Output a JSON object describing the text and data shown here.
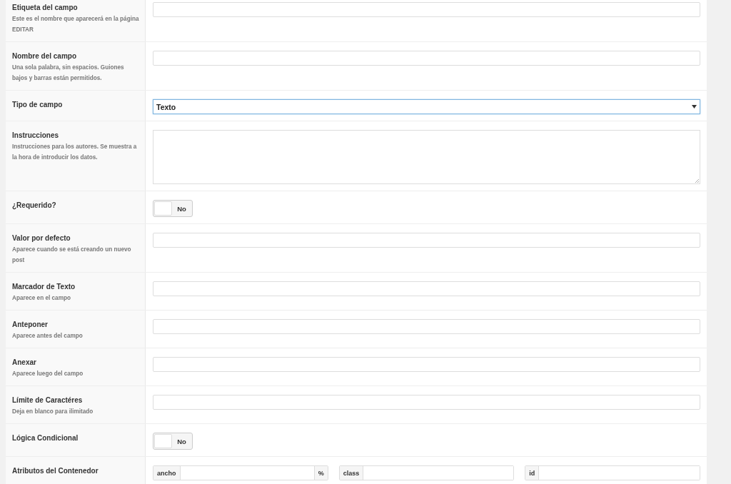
{
  "fields": [
    {
      "kind": "text",
      "label": "Etiqueta del campo",
      "description": "Este es el nombre que aparecerá en la página EDITAR"
    },
    {
      "kind": "text",
      "label": "Nombre del campo",
      "description": "Una sola palabra, sin espacios. Guiones bajos y barras están permitidos."
    },
    {
      "kind": "select",
      "label": "Tipo de campo",
      "value": "Texto"
    },
    {
      "kind": "textarea",
      "label": "Instrucciones",
      "description": "Instrucciones para los autores. Se muestra a la hora de introducir los datos."
    },
    {
      "kind": "toggle",
      "label": "¿Requerido?",
      "on": false,
      "state_label": "No"
    },
    {
      "kind": "text",
      "label": "Valor por defecto",
      "description": "Aparece cuando se está creando un nuevo post"
    },
    {
      "kind": "text",
      "label": "Marcador de Texto",
      "description": "Aparece en el campo"
    },
    {
      "kind": "text",
      "label": "Anteponer",
      "description": "Aparece antes del campo"
    },
    {
      "kind": "text",
      "label": "Anexar",
      "description": "Aparece luego del campo"
    },
    {
      "kind": "text",
      "label": "Límite de Caractéres",
      "description": "Deja en blanco para ilimitado"
    },
    {
      "kind": "toggle",
      "label": "Lógica Condicional",
      "on": false,
      "state_label": "No"
    },
    {
      "kind": "attributes",
      "label": "Atributos del Contenedor",
      "inputs": [
        {
          "prepend": "ancho",
          "append": "%"
        },
        {
          "prepend": "class"
        },
        {
          "prepend": "id"
        }
      ]
    }
  ]
}
